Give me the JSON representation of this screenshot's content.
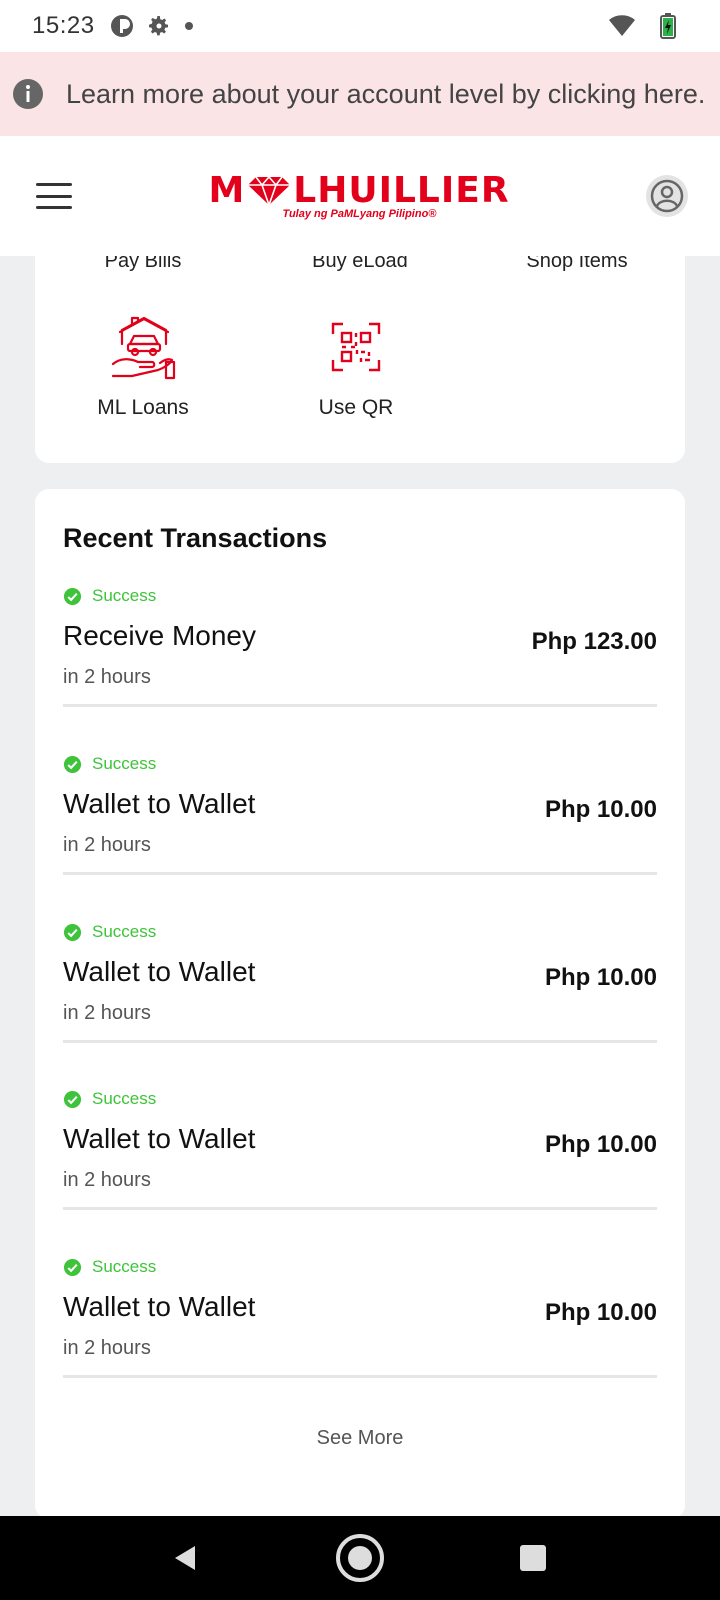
{
  "status_bar": {
    "time": "15:23",
    "icons": [
      "app-circle-icon",
      "gear-icon",
      "dot-icon",
      "wifi-icon",
      "battery-icon"
    ]
  },
  "banner": {
    "text": "Learn more about your account level by clicking here.",
    "icon": "info-icon"
  },
  "header": {
    "logo_text": "LHUILLIER",
    "logo_prefix": "M",
    "tagline": "Tulay ng PaMLyang Pilipino®",
    "menu_icon": "hamburger-icon",
    "profile_icon": "user-avatar-icon"
  },
  "services": {
    "clipped_labels": [
      "Pay Bills",
      "Buy eLoad",
      "Shop Items"
    ],
    "items": [
      {
        "label": "ML Loans",
        "icon": "house-car-hand-icon"
      },
      {
        "label": "Use QR",
        "icon": "qr-scan-icon"
      }
    ]
  },
  "transactions": {
    "title": "Recent Transactions",
    "items": [
      {
        "status": "Success",
        "name": "Receive Money",
        "time": "in 2 hours",
        "amount": "Php 123.00"
      },
      {
        "status": "Success",
        "name": "Wallet to Wallet",
        "time": "in 2 hours",
        "amount": "Php 10.00"
      },
      {
        "status": "Success",
        "name": "Wallet to Wallet",
        "time": "in 2 hours",
        "amount": "Php 10.00"
      },
      {
        "status": "Success",
        "name": "Wallet to Wallet",
        "time": "in 2 hours",
        "amount": "Php 10.00"
      },
      {
        "status": "Success",
        "name": "Wallet to Wallet",
        "time": "in 2 hours",
        "amount": "Php 10.00"
      }
    ],
    "see_more": "See More"
  },
  "colors": {
    "brand_red": "#e3001b",
    "success_green": "#3ec33a",
    "banner_bg": "#fbe4e6",
    "page_bg": "#eeeff1"
  },
  "nav_bar": {
    "icons": [
      "back-icon",
      "home-icon",
      "recents-icon"
    ]
  }
}
